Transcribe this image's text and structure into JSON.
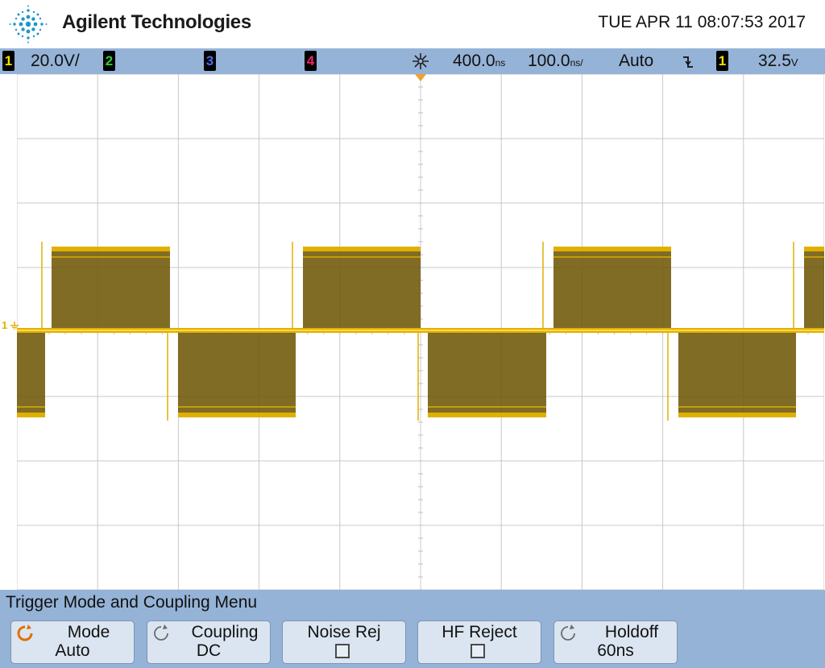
{
  "header": {
    "brand": "Agilent Technologies",
    "datetime": "TUE APR 11 08:07:53 2017"
  },
  "status_bar": {
    "channels": [
      {
        "id": "1",
        "color": "#f2e200",
        "scale": "20.0V/"
      },
      {
        "id": "2",
        "color": "#30d030",
        "scale": ""
      },
      {
        "id": "3",
        "color": "#4a6cf0",
        "scale": ""
      },
      {
        "id": "4",
        "color": "#f02070",
        "scale": ""
      }
    ],
    "time_delay": "400.0",
    "time_delay_unit": "ns",
    "time_scale": "100.0",
    "time_scale_unit": "ns/",
    "trigger_mode": "Auto",
    "trigger_slope_icon": "falling-edge-icon",
    "trigger_source": "1",
    "trigger_level": "32.5",
    "trigger_level_unit": "V"
  },
  "waveform": {
    "channel": "1",
    "color": "#e0b000",
    "dark_color": "#6b5200",
    "ground_marker": "1"
  },
  "menu": {
    "title": "Trigger Mode and Coupling Menu",
    "softkeys": [
      {
        "label": "Mode",
        "value": "Auto",
        "icon": "rotate-knob-icon",
        "active": true
      },
      {
        "label": "Coupling",
        "value": "DC",
        "icon": "rotate-knob-icon",
        "active": false
      },
      {
        "label": "Noise Rej",
        "value": "",
        "checkbox": false
      },
      {
        "label": "HF Reject",
        "value": "",
        "checkbox": false
      },
      {
        "label": "Holdoff",
        "value": "60ns",
        "icon": "rotate-knob-icon",
        "active": false
      }
    ]
  }
}
